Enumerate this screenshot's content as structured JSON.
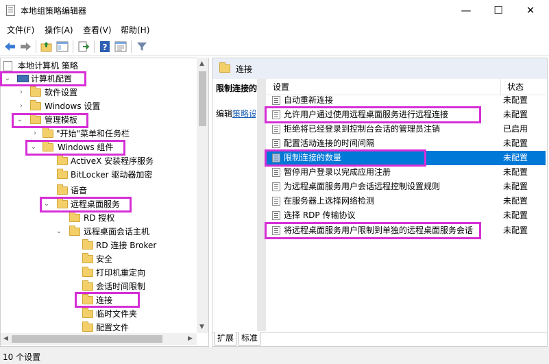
{
  "window": {
    "title": "本地组策略编辑器",
    "minimize": "—",
    "maximize": "☐",
    "close": "✕"
  },
  "menu": [
    {
      "label": "文件(F)"
    },
    {
      "label": "操作(A)"
    },
    {
      "label": "查看(V)"
    },
    {
      "label": "帮助(H)"
    }
  ],
  "toolbar": {
    "icons": [
      "back-icon",
      "forward-icon",
      "folder-up-icon",
      "show-hide-tree-icon",
      "export-list-icon",
      "help-icon",
      "properties-icon",
      "filter-icon"
    ]
  },
  "tree": {
    "root": "本地计算机 策略",
    "computer_config": "计算机配置",
    "software_settings": "软件设置",
    "windows_settings": "Windows 设置",
    "admin_templates": "管理模板",
    "start_menu": "\"开始\"菜单和任务栏",
    "windows_components": "Windows 组件",
    "activex": "ActiveX 安装程序服务",
    "bitlocker": "BitLocker 驱动器加密",
    "speech": "语音",
    "rds": "远程桌面服务",
    "rd_licensing": "RD 授权",
    "rdsh": "远程桌面会话主机",
    "rd_broker": "RD 连接 Broker",
    "security": "安全",
    "printer_redirect": "打印机重定向",
    "session_time_limits": "会话时间限制",
    "connections": "连接",
    "temp_folders": "临时文件夹",
    "profiles": "配置文件"
  },
  "right": {
    "header_title": "连接",
    "desc_title": "限制连接的数量",
    "desc_edit_prefix": "编辑",
    "desc_edit_link": "策略设置",
    "col_settings": "设置",
    "col_status": "状态",
    "rows": [
      {
        "name": "自动重新连接",
        "status": "未配置"
      },
      {
        "name": "允许用户通过使用远程桌面服务进行远程连接",
        "status": "未配置"
      },
      {
        "name": "拒绝将已经登录到控制台会话的管理员注销",
        "status": "已启用"
      },
      {
        "name": "配置活动连接的时间间隔",
        "status": "未配置"
      },
      {
        "name": "限制连接的数量",
        "status": "未配置"
      },
      {
        "name": "暂停用户登录以完成应用注册",
        "status": "未配置"
      },
      {
        "name": "为远程桌面服务用户会话远程控制设置规则",
        "status": "未配置"
      },
      {
        "name": "在服务器上选择网络检测",
        "status": "未配置"
      },
      {
        "name": "选择 RDP 传输协议",
        "status": "未配置"
      },
      {
        "name": "将远程桌面服务用户限制到单独的远程桌面服务会话",
        "status": "未配置"
      }
    ],
    "tabs": [
      {
        "label": "扩展"
      },
      {
        "label": "标准"
      }
    ]
  },
  "status_bar": {
    "text": "10 个设置"
  },
  "highlight_color": "#d62ed6",
  "selection_color": "#0078d7"
}
